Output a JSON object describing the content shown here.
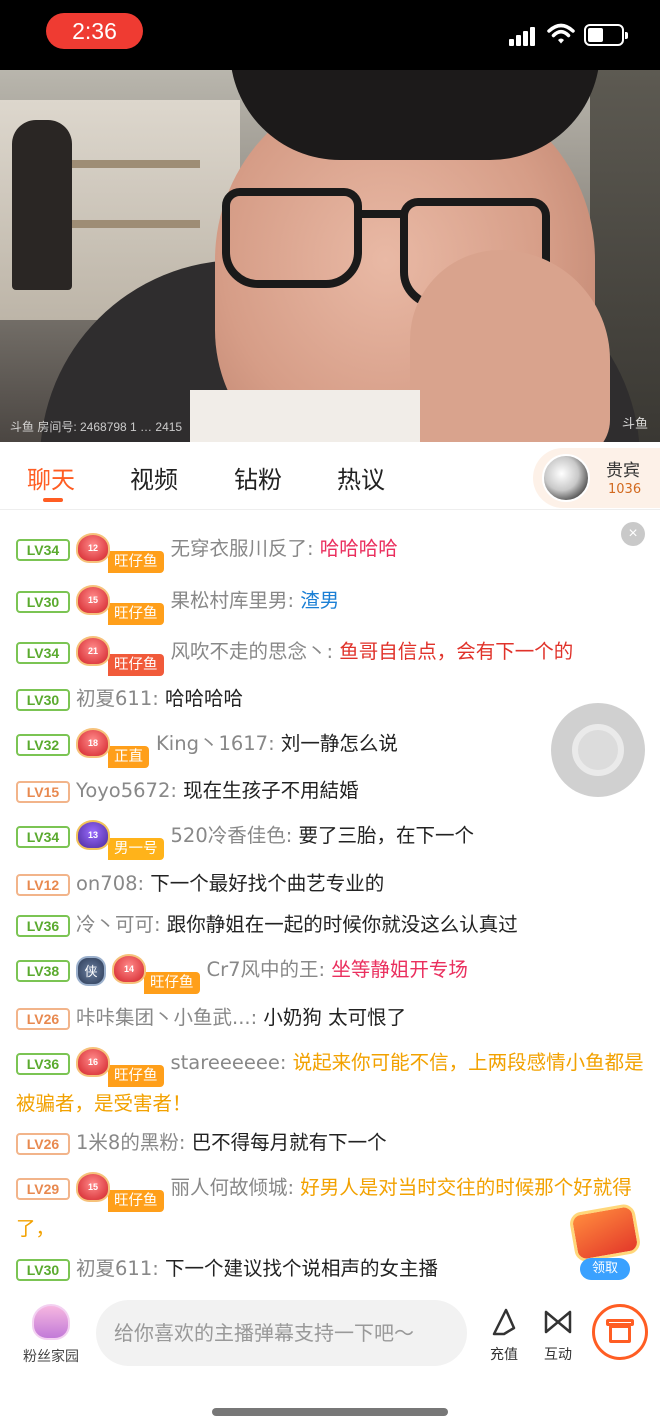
{
  "status_bar": {
    "time": "2:36"
  },
  "video": {
    "watermark_left": "斗鱼 房间号: 2468798 1 … 2415",
    "watermark_right": "斗鱼"
  },
  "tabs": [
    "聊天",
    "视频",
    "钻粉",
    "热议"
  ],
  "vip": {
    "title": "贵宾",
    "count": "1036"
  },
  "chat": [
    {
      "level": "LV34",
      "fan_badge": "旺仔鱼",
      "fan_lvl": "12",
      "name": "无穿衣服川反了",
      "sep": ": ",
      "msg": "哈哈哈哈"
    },
    {
      "level": "LV30",
      "fan_badge": "旺仔鱼",
      "fan_lvl": "15",
      "name": "果松村库里男",
      "sep": ": ",
      "msg": "渣男"
    },
    {
      "level": "LV34",
      "fan_badge": "旺仔鱼",
      "fan_lvl": "21",
      "name": "风吹不走的思念丶",
      "sep": ": ",
      "msg": "鱼哥自信点，会有下一个的"
    },
    {
      "level": "LV30",
      "name": "初夏611",
      "sep": ": ",
      "msg": "哈哈哈哈"
    },
    {
      "level": "LV32",
      "fan_badge": "正直",
      "fan_lvl": "18",
      "name": "King丶1617",
      "sep": ": ",
      "msg": "刘一静怎么说"
    },
    {
      "level": "LV15",
      "name": "Yoyo5672",
      "sep": ": ",
      "msg": "现在生孩子不用結婚"
    },
    {
      "level": "LV34",
      "fan_badge": "男一号",
      "fan_lvl": "13",
      "name": "520冷香佳色",
      "sep": ": ",
      "msg": "要了三胎，在下一个"
    },
    {
      "level": "LV12",
      "name": "on708",
      "sep": ": ",
      "msg": "下一个最好找个曲艺专业的"
    },
    {
      "level": "LV36",
      "name": "冷丶可可",
      "sep": ": ",
      "msg": "跟你静姐在一起的时候你就没这么认真过"
    },
    {
      "level": "LV38",
      "noble": "侠",
      "fan_badge": "旺仔鱼",
      "fan_lvl": "14",
      "name": "Cr7风中的王",
      "sep": ": ",
      "msg": "坐等静姐开专场"
    },
    {
      "level": "LV26",
      "name": "咔咔集团丶小鱼武...",
      "sep": ": ",
      "msg": "小奶狗 太可恨了"
    },
    {
      "level": "LV36",
      "fan_badge": "旺仔鱼",
      "fan_lvl": "16",
      "name": "stareeeeee",
      "sep": ": ",
      "msg": "说起来你可能不信，上两段感情小鱼都是被骗者，是受害者！"
    },
    {
      "level": "LV26",
      "name": "1米8的黑粉",
      "sep": ": ",
      "msg": "巴不得每月就有下一个"
    },
    {
      "level": "LV29",
      "fan_badge": "旺仔鱼",
      "fan_lvl": "15",
      "name": "丽人何故倾城",
      "sep": ": ",
      "msg": "好男人是对当时交往的时候那个好就得了，"
    },
    {
      "level": "LV30",
      "name": "初夏611",
      "sep": ": ",
      "msg": "下一个建议找个说相声的女主播"
    }
  ],
  "redpack": {
    "claim_label": "领取"
  },
  "bottom": {
    "fan_home_label": "粉丝家园",
    "input_placeholder": "给你喜欢的主播弹幕支持一下吧～",
    "recharge_label": "充值",
    "interact_label": "互动"
  },
  "colors": {
    "accent": "#ff5d23",
    "status_pill": "#ef3b32",
    "level_green": "#5aaa2e",
    "level_orange": "#e8894f"
  }
}
